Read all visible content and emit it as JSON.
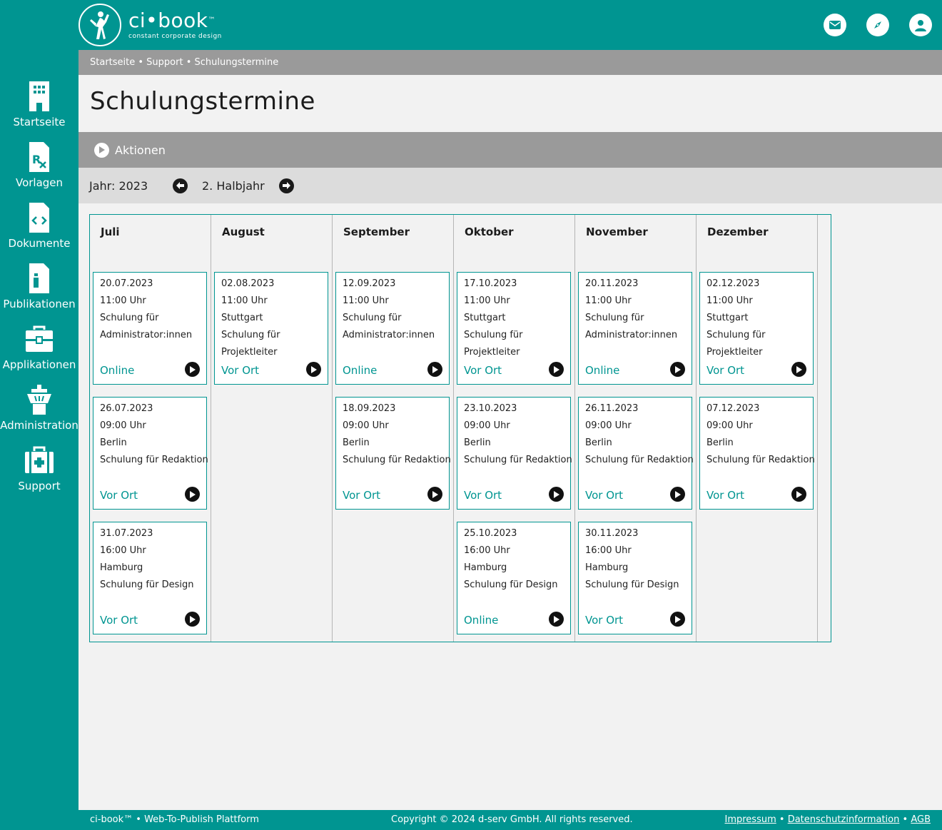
{
  "app": {
    "logo_name": "ci•book",
    "logo_tm": "™",
    "logo_subtitle": "constant corporate design"
  },
  "top_icons": [
    "mail-icon",
    "compass-icon",
    "user-icon"
  ],
  "sidebar": {
    "items": [
      {
        "label": "Startseite",
        "icon": "building-icon"
      },
      {
        "label": "Vorlagen",
        "icon": "prescription-document-icon"
      },
      {
        "label": "Dokumente",
        "icon": "code-document-icon"
      },
      {
        "label": "Publikationen",
        "icon": "bottle-document-icon"
      },
      {
        "label": "Applikationen",
        "icon": "toolbox-icon"
      },
      {
        "label": "Administration",
        "icon": "tower-icon"
      },
      {
        "label": "Support",
        "icon": "first-aid-kit-icon"
      }
    ]
  },
  "breadcrumb": "Startseite • Support • Schulungstermine",
  "page_title": "Schulungstermine",
  "actions_label": "Aktionen",
  "year_label": "Jahr: 2023",
  "half_label": "2. Halbjahr",
  "months": [
    {
      "name": "Juli",
      "events": [
        {
          "date": "20.07.2023",
          "time": "11:00 Uhr",
          "lines": [
            "Schulung für",
            "Administrator:innen"
          ],
          "type": "Online"
        },
        {
          "date": "26.07.2023",
          "time": "09:00 Uhr",
          "lines": [
            "Berlin",
            "Schulung für Redaktion"
          ],
          "type": "Vor Ort"
        },
        {
          "date": "31.07.2023",
          "time": "16:00 Uhr",
          "lines": [
            "Hamburg",
            "Schulung für Design"
          ],
          "type": "Vor Ort"
        }
      ]
    },
    {
      "name": "August",
      "events": [
        {
          "date": "02.08.2023",
          "time": "11:00 Uhr",
          "lines": [
            "Stuttgart",
            "Schulung für",
            "Projektleiter"
          ],
          "type": "Vor Ort"
        }
      ]
    },
    {
      "name": "September",
      "events": [
        {
          "date": "12.09.2023",
          "time": "11:00 Uhr",
          "lines": [
            "Schulung für",
            "Administrator:innen"
          ],
          "type": "Online"
        },
        {
          "date": "18.09.2023",
          "time": "09:00 Uhr",
          "lines": [
            "Berlin",
            "Schulung für Redaktion"
          ],
          "type": "Vor Ort"
        }
      ]
    },
    {
      "name": "Oktober",
      "events": [
        {
          "date": "17.10.2023",
          "time": "11:00 Uhr",
          "lines": [
            "Stuttgart",
            "Schulung für",
            "Projektleiter"
          ],
          "type": "Vor Ort"
        },
        {
          "date": "23.10.2023",
          "time": "09:00 Uhr",
          "lines": [
            "Berlin",
            "Schulung für Redaktion"
          ],
          "type": "Vor Ort"
        },
        {
          "date": "25.10.2023",
          "time": "16:00 Uhr",
          "lines": [
            "Hamburg",
            "Schulung für Design"
          ],
          "type": "Online"
        }
      ]
    },
    {
      "name": "November",
      "events": [
        {
          "date": "20.11.2023",
          "time": "11:00 Uhr",
          "lines": [
            "Schulung für",
            "Administrator:innen"
          ],
          "type": "Online"
        },
        {
          "date": "26.11.2023",
          "time": "09:00 Uhr",
          "lines": [
            "Berlin",
            "Schulung für Redaktion"
          ],
          "type": "Vor Ort"
        },
        {
          "date": "30.11.2023",
          "time": "16:00 Uhr",
          "lines": [
            "Hamburg",
            "Schulung für Design"
          ],
          "type": "Vor Ort"
        }
      ]
    },
    {
      "name": "Dezember",
      "events": [
        {
          "date": "02.12.2023",
          "time": "11:00 Uhr",
          "lines": [
            "Stuttgart",
            "Schulung für",
            "Projektleiter"
          ],
          "type": "Vor Ort"
        },
        {
          "date": "07.12.2023",
          "time": "09:00 Uhr",
          "lines": [
            "Berlin",
            "Schulung für Redaktion"
          ],
          "type": "Vor Ort"
        }
      ]
    }
  ],
  "footer": {
    "left": "ci-book™ • Web-To-Publish Plattform",
    "copyright": "Copyright © 2024 d-serv GmbH. All rights reserved.",
    "impressum": "Impressum",
    "datenschutz": "Datenschutzinformation",
    "agb": "AGB",
    "separator": "•"
  },
  "colors": {
    "brand": "#009591",
    "bar_gray": "#9a9a9a",
    "yearbar_gray": "#dcdcdc"
  }
}
